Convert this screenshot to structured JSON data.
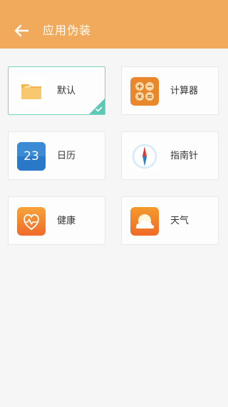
{
  "header": {
    "title": "应用伪装",
    "bg_color": "#f1a95c"
  },
  "options": [
    {
      "label": "默认",
      "icon": "folder-icon",
      "selected": true
    },
    {
      "label": "计算器",
      "icon": "calculator-icon",
      "selected": false
    },
    {
      "label": "日历",
      "icon": "calendar-icon",
      "calendar_day": "23",
      "selected": false
    },
    {
      "label": "指南针",
      "icon": "compass-icon",
      "selected": false
    },
    {
      "label": "健康",
      "icon": "health-heart-icon",
      "selected": false
    },
    {
      "label": "天气",
      "icon": "weather-sun-cloud-icon",
      "selected": false
    }
  ],
  "colors": {
    "selected_accent": "#5cc8b6"
  }
}
